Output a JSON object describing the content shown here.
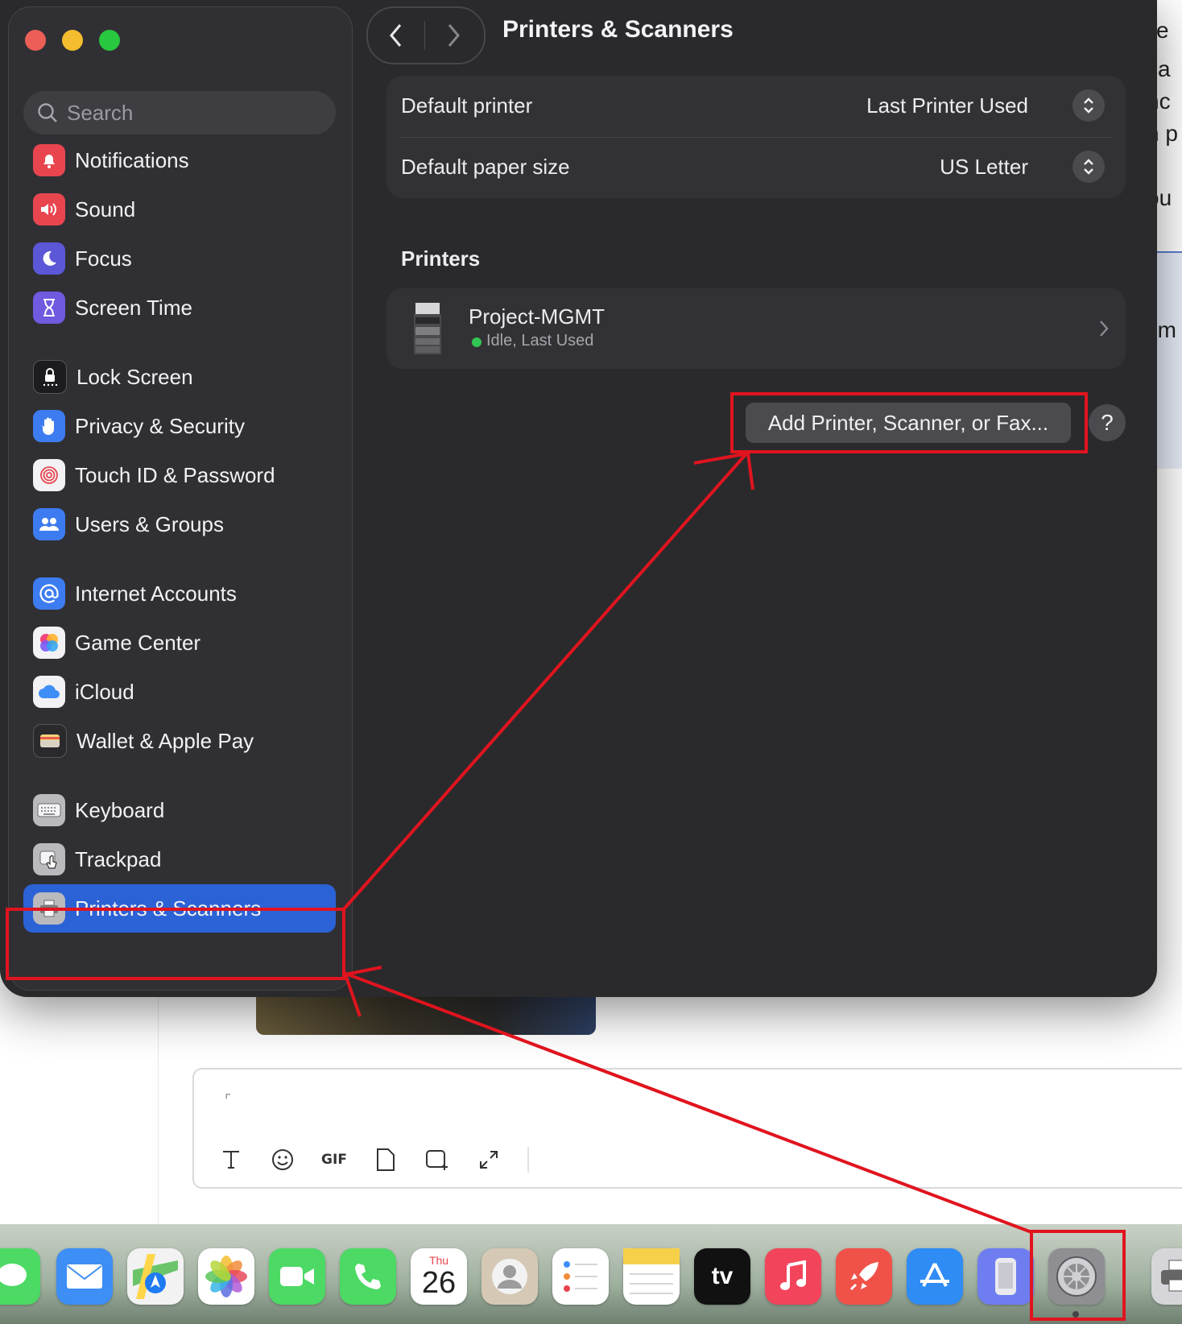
{
  "window": {
    "title": "Printers & Scanners",
    "search_placeholder": "Search"
  },
  "sidebar": {
    "items": [
      {
        "label": "Notifications",
        "icon": "bell-icon",
        "color": "#e8454f"
      },
      {
        "label": "Sound",
        "icon": "speaker-icon",
        "color": "#e8454f"
      },
      {
        "label": "Focus",
        "icon": "moon-icon",
        "color": "#5b57d6"
      },
      {
        "label": "Screen Time",
        "icon": "hourglass-icon",
        "color": "#6f5ae0"
      },
      {
        "label": "Lock Screen",
        "icon": "lock-icon",
        "color": "#1c1c1e"
      },
      {
        "label": "Privacy & Security",
        "icon": "hand-icon",
        "color": "#3d7cf0"
      },
      {
        "label": "Touch ID & Password",
        "icon": "fingerprint-icon",
        "color": "#f2f2f4"
      },
      {
        "label": "Users & Groups",
        "icon": "users-icon",
        "color": "#3d7cf0"
      },
      {
        "label": "Internet Accounts",
        "icon": "at-icon",
        "color": "#3d7cf0"
      },
      {
        "label": "Game Center",
        "icon": "game-center-icon",
        "color": "#f2f2f4"
      },
      {
        "label": "iCloud",
        "icon": "cloud-icon",
        "color": "#f2f2f4"
      },
      {
        "label": "Wallet & Apple Pay",
        "icon": "wallet-icon",
        "color": "#2a2a2d"
      },
      {
        "label": "Keyboard",
        "icon": "keyboard-icon",
        "color": "#8c8c92"
      },
      {
        "label": "Trackpad",
        "icon": "trackpad-icon",
        "color": "#8c8c92"
      },
      {
        "label": "Printers & Scanners",
        "icon": "printer-icon",
        "color": "#8c8c92"
      }
    ],
    "active_item": "Printers & Scanners"
  },
  "defaults": {
    "default_printer_label": "Default printer",
    "default_printer_value": "Last Printer Used",
    "paper_size_label": "Default paper size",
    "paper_size_value": "US Letter"
  },
  "printers": {
    "section_title": "Printers",
    "list": [
      {
        "name": "Project-MGMT",
        "status": "Idle, Last Used",
        "status_color": "#31c653"
      }
    ]
  },
  "add_button_label": "Add Printer, Scanner, or Fax...",
  "help_label": "?",
  "background_text": [
    "e",
    "ca",
    "nc",
    "n p",
    "ou",
    "em"
  ],
  "composer": {
    "gif_label": "GIF",
    "tools": [
      "text-format-icon",
      "emoji-icon",
      "gif-icon",
      "attachment-icon",
      "add-frame-icon",
      "expand-icon"
    ]
  },
  "dock": {
    "calendar_weekday": "Thu",
    "calendar_day": "26",
    "tv_label": "tv",
    "apps": [
      "messages-icon",
      "mail-icon",
      "maps-icon",
      "photos-icon",
      "facetime-icon",
      "phone-icon",
      "calendar-icon",
      "contacts-icon",
      "reminders-icon",
      "notes-icon",
      "appletv-icon",
      "music-icon",
      "rocket-icon",
      "app-store-icon",
      "iphone-mirroring-icon",
      "system-settings-icon",
      "printer-icon"
    ]
  },
  "annotation_color": "#e0141e"
}
